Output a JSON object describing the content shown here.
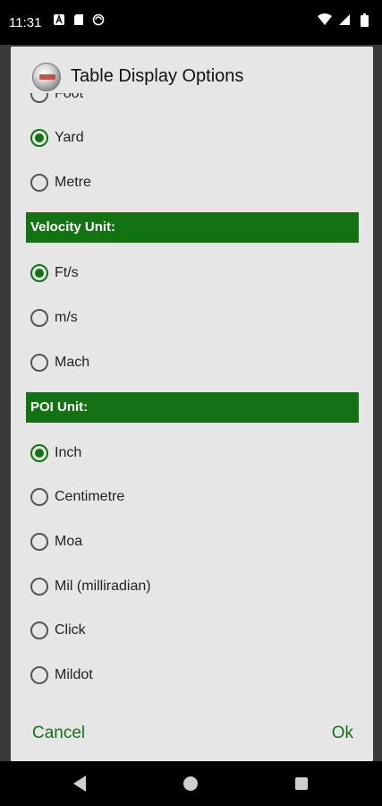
{
  "status_bar": {
    "time": "11:31",
    "left_icons": [
      "notification-a-icon",
      "sd-card-icon",
      "sync-icon"
    ],
    "right_icons": [
      "wifi-icon",
      "signal-icon",
      "battery-icon"
    ]
  },
  "dialog": {
    "title": "Table Display Options",
    "range_options": [
      {
        "label": "Foot",
        "checked": false
      },
      {
        "label": "Yard",
        "checked": true
      },
      {
        "label": "Metre",
        "checked": false
      }
    ],
    "velocity_header": "Velocity Unit:",
    "velocity_options": [
      {
        "label": "Ft/s",
        "checked": true
      },
      {
        "label": "m/s",
        "checked": false
      },
      {
        "label": "Mach",
        "checked": false
      }
    ],
    "poi_header": "POI Unit:",
    "poi_options": [
      {
        "label": "Inch",
        "checked": true
      },
      {
        "label": "Centimetre",
        "checked": false
      },
      {
        "label": "Moa",
        "checked": false
      },
      {
        "label": "Mil (milliradian)",
        "checked": false
      },
      {
        "label": "Click",
        "checked": false
      },
      {
        "label": "Mildot",
        "checked": false
      }
    ],
    "cancel_label": "Cancel",
    "ok_label": "Ok"
  },
  "colors": {
    "accent": "#137313",
    "dialog_bg": "#e6e6e6"
  }
}
